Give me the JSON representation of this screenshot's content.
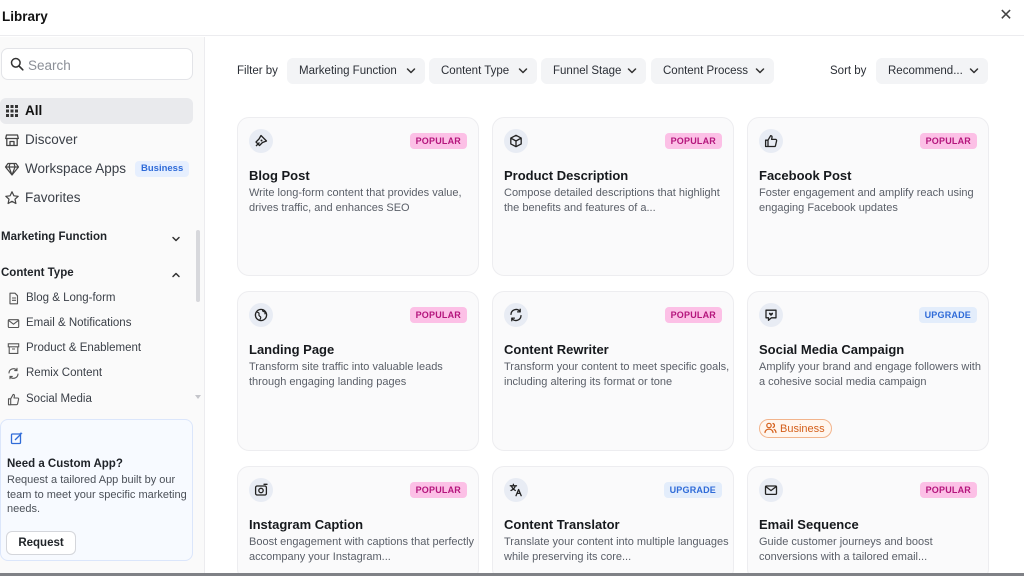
{
  "window": {
    "title": "Library"
  },
  "sidebar": {
    "search_placeholder": "Search",
    "nav": [
      {
        "label": "All",
        "icon": "grid-icon",
        "active": true
      },
      {
        "label": "Discover",
        "icon": "store-icon"
      },
      {
        "label": "Workspace Apps",
        "icon": "gem-icon",
        "badge": "Business"
      },
      {
        "label": "Favorites",
        "icon": "star-icon"
      }
    ],
    "sections": [
      {
        "label": "Marketing Function",
        "expanded": false
      },
      {
        "label": "Content Type",
        "expanded": true
      }
    ],
    "content_types": [
      {
        "label": "Blog & Long-form",
        "icon": "document-icon"
      },
      {
        "label": "Email & Notifications",
        "icon": "mail-icon"
      },
      {
        "label": "Product & Enablement",
        "icon": "archive-icon"
      },
      {
        "label": "Remix Content",
        "icon": "refresh-icon"
      },
      {
        "label": "Social Media",
        "icon": "thumbs-up-icon"
      }
    ],
    "promo": {
      "title": "Need a Custom App?",
      "text": "Request a tailored App built by our team to meet your specific marketing needs.",
      "button": "Request"
    }
  },
  "filters": {
    "label": "Filter by",
    "options": [
      "Marketing Function",
      "Content Type",
      "Funnel Stage",
      "Content Process"
    ],
    "sort_label": "Sort by",
    "sort_value": "Recommend..."
  },
  "cards": [
    {
      "title": "Blog Post",
      "desc": "Write long-form content that provides value, drives traffic, and enhances SEO",
      "badge": "POPULAR",
      "icon": "pen-icon"
    },
    {
      "title": "Product Description",
      "desc": "Compose detailed descriptions that highlight the benefits and features of a...",
      "badge": "POPULAR",
      "icon": "box-icon"
    },
    {
      "title": "Facebook Post",
      "desc": "Foster engagement and amplify reach using engaging Facebook updates",
      "badge": "POPULAR",
      "icon": "thumbs-up-icon"
    },
    {
      "title": "Landing Page",
      "desc": "Transform site traffic into valuable leads through engaging landing pages",
      "badge": "POPULAR",
      "icon": "globe-icon"
    },
    {
      "title": "Content Rewriter",
      "desc": "Transform your content to meet specific goals, including altering its format or tone",
      "badge": "POPULAR",
      "icon": "refresh-icon"
    },
    {
      "title": "Social Media Campaign",
      "desc": "Amplify your brand and engage followers with a cohesive social media campaign",
      "badge": "UPGRADE",
      "icon": "chat-heart-icon",
      "tag": "Business"
    },
    {
      "title": "Instagram Caption",
      "desc": "Boost engagement with captions that perfectly accompany your Instagram...",
      "badge": "POPULAR",
      "icon": "camera-icon"
    },
    {
      "title": "Content Translator",
      "desc": "Translate your content into multiple languages while preserving its core...",
      "badge": "UPGRADE",
      "icon": "translate-icon"
    },
    {
      "title": "Email Sequence",
      "desc": "Guide customer journeys and boost conversions with a tailored email...",
      "badge": "POPULAR",
      "icon": "mail-icon"
    }
  ]
}
